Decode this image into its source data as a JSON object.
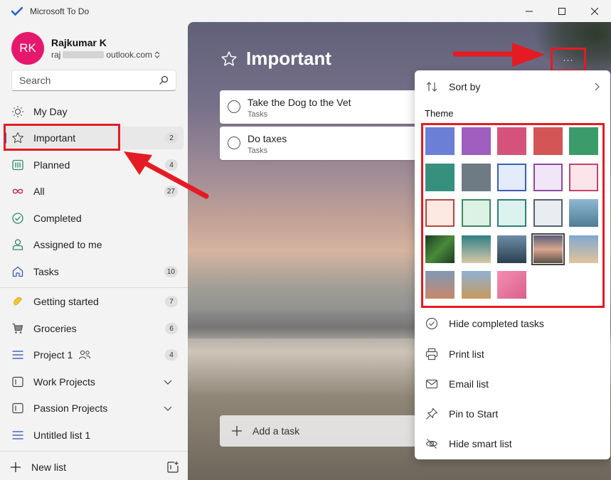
{
  "window": {
    "title": "Microsoft To Do"
  },
  "profile": {
    "initials": "RK",
    "name": "Rajkumar K",
    "email_prefix": "raj",
    "email_suffix": "outlook.com"
  },
  "search": {
    "placeholder": "Search"
  },
  "smart_lists": [
    {
      "label": "My Day",
      "icon": "sun-icon",
      "count": ""
    },
    {
      "label": "Important",
      "icon": "star-icon",
      "count": "2"
    },
    {
      "label": "Planned",
      "icon": "calendar-icon",
      "count": "4"
    },
    {
      "label": "All",
      "icon": "infinity-icon",
      "count": "27"
    },
    {
      "label": "Completed",
      "icon": "check-circle-icon",
      "count": ""
    },
    {
      "label": "Assigned to me",
      "icon": "person-icon",
      "count": ""
    },
    {
      "label": "Tasks",
      "icon": "home-icon",
      "count": "10"
    }
  ],
  "custom_lists": [
    {
      "label": "Getting started",
      "icon": "wave-hand-icon",
      "count": "7"
    },
    {
      "label": "Groceries",
      "icon": "cart-icon",
      "count": "6"
    },
    {
      "label": "Project 1",
      "icon": "list-icon",
      "count": "4"
    },
    {
      "label": "Work Projects",
      "icon": "group-icon"
    },
    {
      "label": "Passion Projects",
      "icon": "group-icon"
    },
    {
      "label": "Untitled list 1",
      "icon": "list-icon",
      "count": ""
    }
  ],
  "new_list": {
    "label": "New list"
  },
  "main": {
    "title": "Important",
    "tasks": [
      {
        "title": "Take the Dog to the Vet",
        "list": "Tasks"
      },
      {
        "title": "Do taxes",
        "list": "Tasks"
      }
    ],
    "add_task": "Add a task",
    "more_label": "···"
  },
  "menu": {
    "sort_by": "Sort by",
    "theme_label": "Theme",
    "items": [
      "Hide completed tasks",
      "Print list",
      "Email list",
      "Pin to Start",
      "Hide smart list"
    ]
  },
  "colors": {
    "accent": "#2564cf",
    "highlight": "#e51b23",
    "avatar": "#e6186d"
  },
  "theme_swatches": [
    {
      "fill": "#6b7fd7",
      "border": ""
    },
    {
      "fill": "#a05ebf",
      "border": ""
    },
    {
      "fill": "#d5537b",
      "border": ""
    },
    {
      "fill": "#d45556",
      "border": ""
    },
    {
      "fill": "#3c9b6b",
      "border": ""
    },
    {
      "fill": "#37907e",
      "border": ""
    },
    {
      "fill": "#6e7a84",
      "border": ""
    },
    {
      "fill": "#e3ecf8",
      "border": "#3c5eb4"
    },
    {
      "fill": "#f1e6f7",
      "border": "#8b4aa6"
    },
    {
      "fill": "#fbe5ea",
      "border": "#c44268"
    },
    {
      "fill": "#fbe9e2",
      "border": "#b3463f"
    },
    {
      "fill": "#dcf2e5",
      "border": "#3c8a5e"
    },
    {
      "fill": "#dcf2ef",
      "border": "#2e7f74"
    },
    {
      "fill": "#e9edf1",
      "border": "#556270"
    },
    {
      "fill": "linear-gradient(180deg,#8fb8d2,#4f7d94)",
      "border": ""
    },
    {
      "fill": "linear-gradient(135deg,#1c3d23,#4a8a3b,#1c3d23)",
      "border": ""
    },
    {
      "fill": "linear-gradient(180deg,#2f7f86,#d8c9a8)",
      "border": ""
    },
    {
      "fill": "linear-gradient(180deg,#6c8da6,#2b3f4f)",
      "border": ""
    },
    {
      "fill": "linear-gradient(180deg,#5a5c78,#d9a890,#5a5046)",
      "border": "",
      "selected": true
    },
    {
      "fill": "linear-gradient(180deg,#7fa8cf,#e1c49b)",
      "border": ""
    },
    {
      "fill": "linear-gradient(180deg,#7f99b5,#c9876a)",
      "border": ""
    },
    {
      "fill": "linear-gradient(180deg,#8fb1d4,#c89a5b)",
      "border": ""
    },
    {
      "fill": "linear-gradient(135deg,#f48fb1,#d9608c)",
      "border": ""
    }
  ]
}
